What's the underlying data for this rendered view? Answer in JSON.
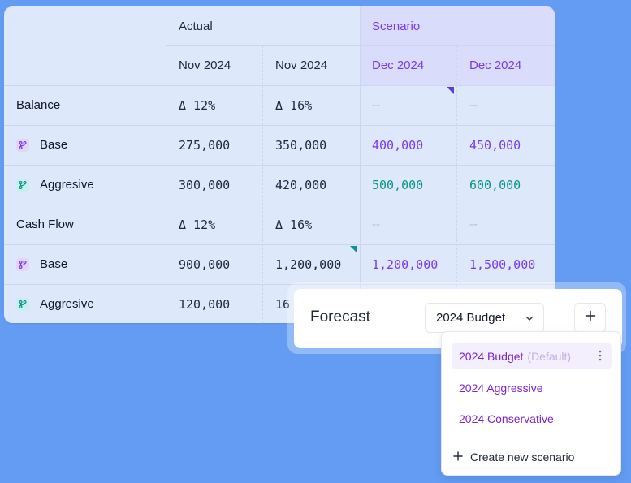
{
  "table": {
    "actual_header": "Actual",
    "scenario_header": "Scenario",
    "col_dates": [
      "Nov 2024",
      "Nov 2024",
      "Dec 2024",
      "Dec 2024"
    ],
    "rows": [
      {
        "label": "Balance",
        "icon": "none",
        "values": [
          "Δ 12%",
          "Δ 16%",
          "--",
          "--"
        ]
      },
      {
        "label": "Base",
        "icon": "branch-icon",
        "values": [
          "275,000",
          "350,000",
          "400,000",
          "450,000"
        ]
      },
      {
        "label": "Aggresive",
        "icon": "branch-icon",
        "values": [
          "300,000",
          "420,000",
          "500,000",
          "600,000"
        ]
      },
      {
        "label": "Cash Flow",
        "icon": "none",
        "values": [
          "Δ 12%",
          "Δ 16%",
          "--",
          "--"
        ]
      },
      {
        "label": "Base",
        "icon": "branch-icon",
        "values": [
          "900,000",
          "1,200,000",
          "1,200,000",
          "1,500,000"
        ]
      },
      {
        "label": "Aggresive",
        "icon": "branch-icon",
        "values": [
          "120,000",
          "16",
          "",
          ""
        ]
      }
    ]
  },
  "forecast": {
    "title": "Forecast",
    "selected_scenario": "2024 Budget"
  },
  "menu": {
    "items": [
      {
        "label": "2024 Budget",
        "suffix": "(Default)"
      },
      {
        "label": "2024 Aggressive",
        "suffix": ""
      },
      {
        "label": "2024 Conservative",
        "suffix": ""
      }
    ],
    "create_label": "Create new scenario"
  },
  "colors": {
    "background": "#649cf4",
    "scenario_purple": "#7c3aed",
    "teal": "#0d9488"
  }
}
